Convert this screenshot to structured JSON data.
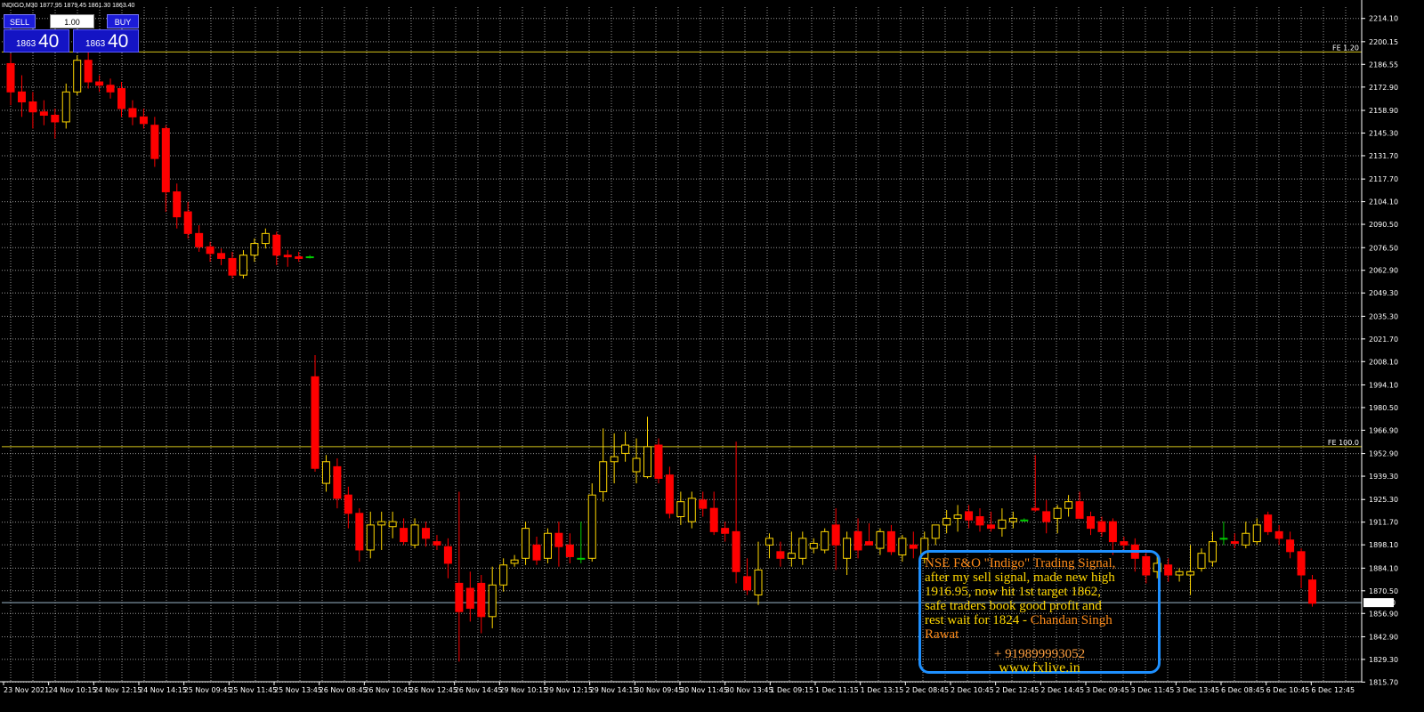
{
  "header": {
    "symbol": "INDIGO,M30",
    "ohlc": "1877.95 1879.45 1861.30 1863.40"
  },
  "trade_panel": {
    "sell_label": "SELL",
    "buy_label": "BUY",
    "lot_value": "1.00",
    "sell_small": "1863",
    "sell_big": "40",
    "buy_small": "1863",
    "buy_big": "40"
  },
  "note": {
    "line1": "NSE F&O \"Indigo\" Trading Signal,",
    "line2": "after my sell signal, made new high",
    "line3": "1916.95, now hit 1st target 1862,",
    "line4": "safe traders book good profit and",
    "line5_a": "rest wait for 1824 - ",
    "line5_b": "Chandan Singh",
    "line6": "Rawat",
    "phone": "+ 919899993052",
    "website": "www.fxlive.in"
  },
  "colors": {
    "background": "#000000",
    "grid": "#c9c9c9",
    "bull": "#ffd700",
    "bear": "#ff0000",
    "doji": "#00cc00",
    "level_line": "#d4c21a",
    "note_border": "#1e90ff"
  },
  "chart_data": {
    "type": "candlestick",
    "ylim": [
      1815.9,
      2220.9
    ],
    "yticks": [
      "2214.10",
      "2200.15",
      "2186.55",
      "2172.90",
      "2158.90",
      "2145.30",
      "2131.70",
      "2117.70",
      "2104.10",
      "2090.50",
      "2076.50",
      "2062.90",
      "2049.30",
      "2035.30",
      "2021.70",
      "2008.10",
      "1994.10",
      "1980.50",
      "1966.90",
      "1952.90",
      "1939.30",
      "1925.30",
      "1911.70",
      "1898.10",
      "1884.10",
      "1870.50",
      "1856.90",
      "1842.90",
      "1829.30",
      "1815.70"
    ],
    "xticks": [
      "23 Nov 2021",
      "24 Nov 10:15",
      "24 Nov 12:15",
      "24 Nov 14:15",
      "25 Nov 09:45",
      "25 Nov 11:45",
      "25 Nov 13:45",
      "26 Nov 08:45",
      "26 Nov 10:45",
      "26 Nov 12:45",
      "26 Nov 14:45",
      "29 Nov 10:15",
      "29 Nov 12:15",
      "29 Nov 14:15",
      "30 Nov 09:45",
      "30 Nov 11:45",
      "30 Nov 13:45",
      "1 Dec 09:15",
      "1 Dec 11:15",
      "1 Dec 13:15",
      "2 Dec 08:45",
      "2 Dec 10:45",
      "2 Dec 12:45",
      "2 Dec 14:45",
      "3 Dec 09:45",
      "3 Dec 11:45",
      "3 Dec 13:45",
      "6 Dec 08:45",
      "6 Dec 10:45",
      "6 Dec 12:45"
    ],
    "levels": [
      {
        "label": "FE 1.20",
        "price": 2194.0
      },
      {
        "label": "FE 100.0",
        "price": 1957.0
      }
    ],
    "current_price": "1863.40",
    "candles": [
      [
        2187,
        2193,
        2162,
        2170
      ],
      [
        2170,
        2180,
        2155,
        2164
      ],
      [
        2164,
        2170,
        2148,
        2158
      ],
      [
        2158,
        2165,
        2150,
        2156
      ],
      [
        2156,
        2160,
        2142,
        2152
      ],
      [
        2152,
        2175,
        2148,
        2170
      ],
      [
        2170,
        2192,
        2168,
        2189
      ],
      [
        2189,
        2198,
        2172,
        2176
      ],
      [
        2176,
        2180,
        2170,
        2174
      ],
      [
        2174,
        2178,
        2166,
        2170
      ],
      [
        2172,
        2176,
        2155,
        2160
      ],
      [
        2160,
        2165,
        2150,
        2155
      ],
      [
        2155,
        2160,
        2148,
        2151
      ],
      [
        2150,
        2155,
        2125,
        2130
      ],
      [
        2148,
        2150,
        2098,
        2110
      ],
      [
        2110,
        2115,
        2088,
        2095
      ],
      [
        2098,
        2104,
        2082,
        2085
      ],
      [
        2085,
        2090,
        2074,
        2077
      ],
      [
        2077,
        2080,
        2068,
        2073
      ],
      [
        2073,
        2076,
        2066,
        2070
      ],
      [
        2070,
        2074,
        2058,
        2060
      ],
      [
        2060,
        2075,
        2058,
        2072
      ],
      [
        2072,
        2082,
        2068,
        2079
      ],
      [
        2079,
        2088,
        2076,
        2085
      ],
      [
        2084,
        2086,
        2066,
        2072
      ],
      [
        2072,
        2075,
        2065,
        2071
      ],
      [
        2071,
        2074,
        2068,
        2070
      ],
      [
        2071,
        2072,
        2070,
        2071
      ],
      [
        1999,
        2012,
        1942,
        1944
      ],
      [
        1935,
        1952,
        1930,
        1948
      ],
      [
        1945,
        1950,
        1920,
        1926
      ],
      [
        1928,
        1933,
        1908,
        1917
      ],
      [
        1917,
        1920,
        1888,
        1895
      ],
      [
        1895,
        1918,
        1890,
        1910
      ],
      [
        1910,
        1918,
        1895,
        1912
      ],
      [
        1909,
        1918,
        1902,
        1912
      ],
      [
        1908,
        1914,
        1898,
        1900
      ],
      [
        1898,
        1914,
        1896,
        1910
      ],
      [
        1908,
        1912,
        1897,
        1902
      ],
      [
        1900,
        1904,
        1895,
        1898
      ],
      [
        1897,
        1902,
        1878,
        1887
      ],
      [
        1875,
        1930,
        1828,
        1858
      ],
      [
        1872,
        1882,
        1852,
        1860
      ],
      [
        1875,
        1880,
        1845,
        1855
      ],
      [
        1855,
        1885,
        1848,
        1874
      ],
      [
        1874,
        1890,
        1870,
        1886
      ],
      [
        1887,
        1892,
        1885,
        1889
      ],
      [
        1890,
        1912,
        1886,
        1908
      ],
      [
        1898,
        1903,
        1886,
        1889
      ],
      [
        1890,
        1908,
        1887,
        1905
      ],
      [
        1905,
        1912,
        1885,
        1897
      ],
      [
        1898,
        1905,
        1887,
        1891
      ],
      [
        1890,
        1912,
        1887,
        1890
      ],
      [
        1890,
        1935,
        1888,
        1928
      ],
      [
        1930,
        1968,
        1924,
        1948
      ],
      [
        1948,
        1965,
        1935,
        1951
      ],
      [
        1953,
        1966,
        1948,
        1958
      ],
      [
        1942,
        1962,
        1935,
        1950
      ],
      [
        1939,
        1975,
        1938,
        1957
      ],
      [
        1958,
        1962,
        1935,
        1938
      ],
      [
        1940,
        1945,
        1914,
        1917
      ],
      [
        1915,
        1930,
        1910,
        1924
      ],
      [
        1912,
        1930,
        1908,
        1926
      ],
      [
        1925,
        1930,
        1915,
        1920
      ],
      [
        1920,
        1930,
        1904,
        1906
      ],
      [
        1908,
        1912,
        1900,
        1905
      ],
      [
        1906,
        1960,
        1875,
        1882
      ],
      [
        1879,
        1890,
        1868,
        1871
      ],
      [
        1868,
        1900,
        1862,
        1883
      ],
      [
        1898,
        1905,
        1890,
        1902
      ],
      [
        1894,
        1900,
        1885,
        1890
      ],
      [
        1890,
        1906,
        1885,
        1893
      ],
      [
        1890,
        1906,
        1886,
        1902
      ],
      [
        1896,
        1902,
        1893,
        1899
      ],
      [
        1895,
        1908,
        1893,
        1906
      ],
      [
        1910,
        1920,
        1883,
        1898
      ],
      [
        1890,
        1906,
        1880,
        1902
      ],
      [
        1906,
        1914,
        1890,
        1895
      ],
      [
        1900,
        1911,
        1898,
        1898
      ],
      [
        1896,
        1908,
        1892,
        1906
      ],
      [
        1906,
        1910,
        1892,
        1894
      ],
      [
        1892,
        1904,
        1888,
        1902
      ],
      [
        1898,
        1906,
        1890,
        1896
      ],
      [
        1890,
        1906,
        1887,
        1902
      ],
      [
        1902,
        1910,
        1898,
        1910
      ],
      [
        1910,
        1919,
        1905,
        1914
      ],
      [
        1914,
        1922,
        1906,
        1916
      ],
      [
        1918,
        1922,
        1908,
        1913
      ],
      [
        1915,
        1920,
        1906,
        1910
      ],
      [
        1910,
        1918,
        1906,
        1908
      ],
      [
        1908,
        1920,
        1903,
        1913
      ],
      [
        1912,
        1918,
        1908,
        1914
      ],
      [
        1913,
        1914,
        1912,
        1913
      ],
      [
        1920,
        1952,
        1918,
        1919
      ],
      [
        1918,
        1925,
        1905,
        1912
      ],
      [
        1914,
        1922,
        1905,
        1920
      ],
      [
        1920,
        1928,
        1915,
        1924
      ],
      [
        1924,
        1930,
        1918,
        1914
      ],
      [
        1915,
        1918,
        1904,
        1908
      ],
      [
        1912,
        1915,
        1903,
        1906
      ],
      [
        1912,
        1914,
        1892,
        1900
      ],
      [
        1900,
        1903,
        1894,
        1898
      ],
      [
        1898,
        1902,
        1882,
        1890
      ],
      [
        1891,
        1894,
        1875,
        1880
      ],
      [
        1882,
        1892,
        1878,
        1887
      ],
      [
        1886,
        1890,
        1876,
        1880
      ],
      [
        1880,
        1884,
        1876,
        1882
      ],
      [
        1880,
        1898,
        1868,
        1882
      ],
      [
        1884,
        1896,
        1882,
        1893
      ],
      [
        1888,
        1906,
        1885,
        1900
      ],
      [
        1902,
        1912,
        1898,
        1902
      ],
      [
        1900,
        1905,
        1896,
        1899
      ],
      [
        1898,
        1912,
        1896,
        1905
      ],
      [
        1900,
        1914,
        1898,
        1910
      ],
      [
        1916,
        1918,
        1904,
        1906
      ],
      [
        1906,
        1910,
        1898,
        1902
      ],
      [
        1901,
        1906,
        1890,
        1894
      ],
      [
        1894,
        1896,
        1872,
        1880
      ],
      [
        1877,
        1880,
        1861,
        1863
      ]
    ]
  }
}
